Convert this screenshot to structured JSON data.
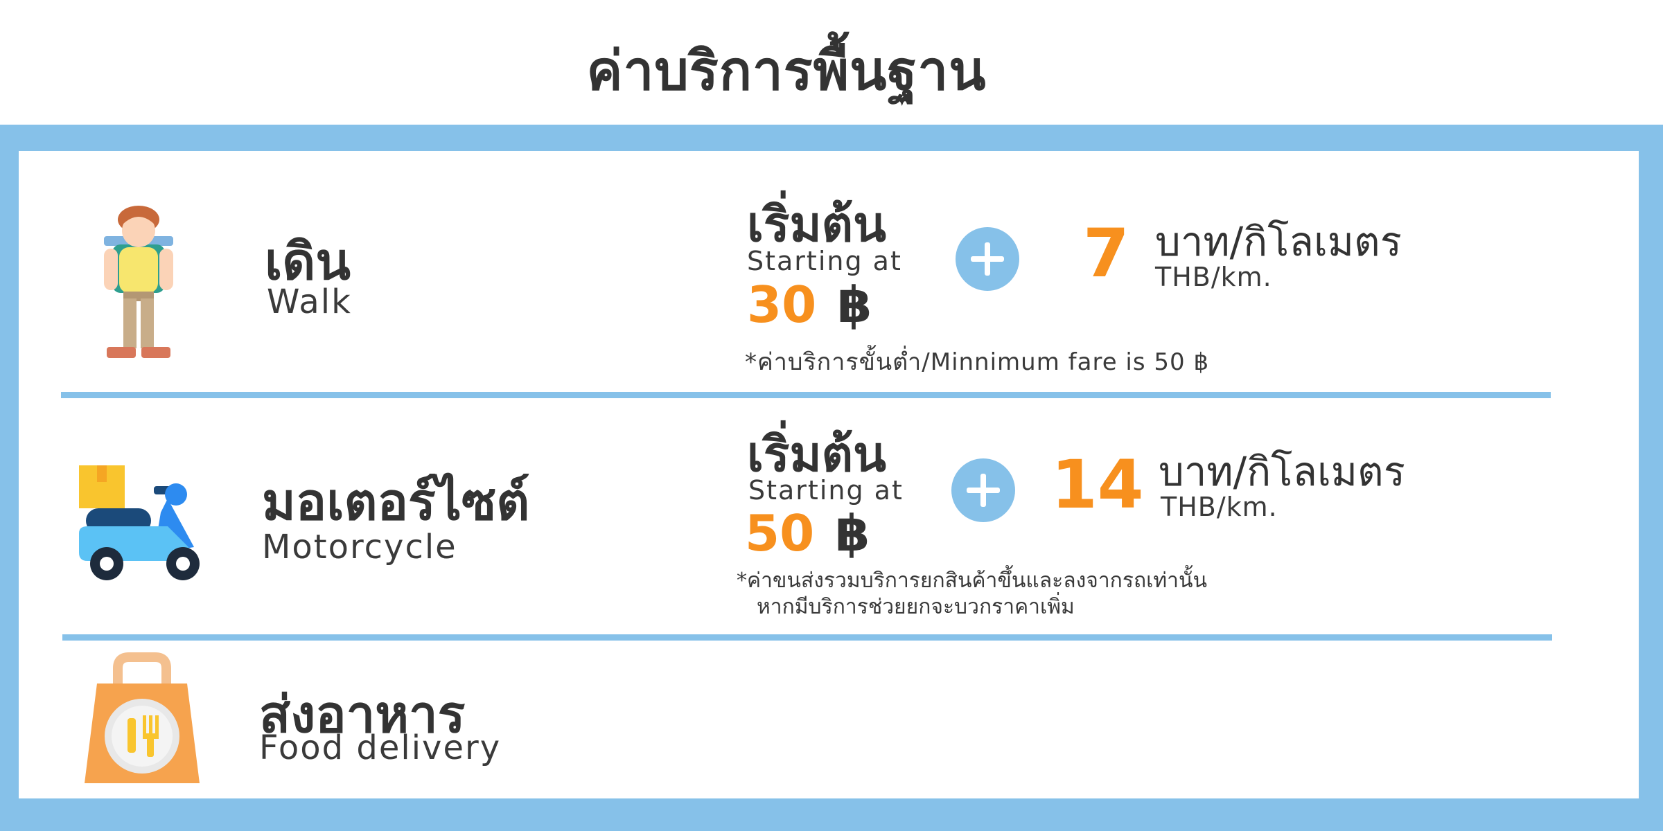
{
  "header": {
    "title": "ค่าบริการพื้นฐาน"
  },
  "services": [
    {
      "name_th": "เดิน",
      "name_en": "Walk",
      "icon": "walker-icon",
      "start_th": "เริ่มต้น",
      "start_en": "Starting at",
      "base_price": "30",
      "currency": "฿",
      "per_km_rate": "7",
      "unit_th": "บาท/กิโลเมตร",
      "unit_en": "THB/km.",
      "note": "*ค่าบริการขั้นต่ำ/Minnimum fare is 50 ฿"
    },
    {
      "name_th": "มอเตอร์ไซต์",
      "name_en": "Motorcycle",
      "icon": "scooter-icon",
      "start_th": "เริ่มต้น",
      "start_en": "Starting at",
      "base_price": "50",
      "currency": "฿",
      "per_km_rate": "14",
      "unit_th": "บาท/กิโลเมตร",
      "unit_en": "THB/km.",
      "note_line1": "*ค่าขนส่งรวมบริการยกสินค้าขึ้นและลงจากรถเท่านั้น",
      "note_line2": "หากมีบริการช่วยยกจะบวกราคาเพิ่ม"
    },
    {
      "name_th": "ส่งอาหาร",
      "name_en": "Food delivery",
      "icon": "food-bag-icon"
    }
  ],
  "colors": {
    "accent_blue": "#86c1e9",
    "price_orange": "#f7901e",
    "text_dark": "#333333"
  }
}
